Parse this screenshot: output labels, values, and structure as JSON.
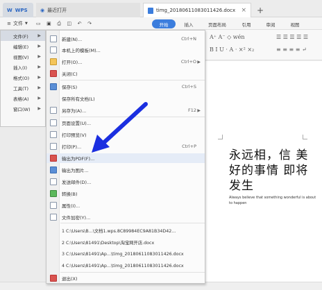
{
  "tabs": {
    "wps": "WPS",
    "recent": "最近打开",
    "doc": "timg_20180611083011426.docx",
    "new_tab": "+"
  },
  "toolbar": {
    "file_menu": "文件",
    "ribbon_tabs": [
      "开始",
      "插入",
      "页面布局",
      "引用",
      "审阅",
      "视图"
    ]
  },
  "ribbon": {
    "font_format": "A⁺ A⁻  ◇  wén",
    "style_row": "B  I  U  ·  A  ·  ×²  ×₂",
    "para_row": "☰ ☰ ☰ ☰ ☰",
    "para_row2": "≡ ≡ ≡ ≡  ↵"
  },
  "submenu": {
    "items": [
      {
        "label": "文件(F)",
        "active": true
      },
      {
        "label": "编辑(E)"
      },
      {
        "label": "视图(V)"
      },
      {
        "label": "插入(I)"
      },
      {
        "label": "格式(O)"
      },
      {
        "label": "工具(T)"
      },
      {
        "label": "表格(A)"
      },
      {
        "label": "窗口(W)"
      }
    ]
  },
  "menu": {
    "items": [
      {
        "label": "新建(N)...",
        "shortcut": "Ctrl+N",
        "icon": "new-document-icon"
      },
      {
        "label": "本机上的模板(M)...",
        "icon": "template-icon"
      },
      {
        "label": "打开(O)...",
        "shortcut": "Ctrl+O",
        "icon": "open-folder-icon"
      },
      {
        "label": "关闭(C)",
        "icon": "close-document-icon"
      },
      {
        "label": "保存(S)",
        "shortcut": "Ctrl+S",
        "icon": "save-icon"
      },
      {
        "label": "保存所有文档(L)",
        "icon": "save-all-icon"
      },
      {
        "label": "另存为(A)...",
        "shortcut": "F12",
        "icon": "save-as-icon"
      },
      {
        "label": "页面设置(U)...",
        "icon": "page-setup-icon"
      },
      {
        "label": "打印预览(V)",
        "icon": "print-preview-icon"
      },
      {
        "label": "打印(P)...",
        "shortcut": "Ctrl+P",
        "icon": "print-icon"
      },
      {
        "label": "输出为PDF(F)...",
        "icon": "pdf-export-icon"
      },
      {
        "label": "输出为图片...",
        "icon": "image-export-icon"
      },
      {
        "label": "发送邮件(D)...",
        "icon": "mail-icon"
      },
      {
        "label": "转换(B)",
        "icon": "convert-icon"
      },
      {
        "label": "属性(I)...",
        "icon": "properties-icon"
      },
      {
        "label": "文件加密(Y)...",
        "icon": "encrypt-icon"
      }
    ],
    "recent_files": [
      "1 C:\\Users\\B...\\文档1.wps.8C89984EC9A81B34D42...",
      "2 C:\\Users\\81491\\Desktop\\淘宝网开店.docx",
      "3 C:\\Users\\81491\\Ap...\\timg_20180611083011426.docx",
      "4 C:\\Users\\81491\\Ap...\\timg_20180611083011426.docx"
    ],
    "exit": "退出(X)"
  },
  "document": {
    "heading": "永远相，信 美好的事情 即将发生",
    "subtitle": "Always believe that something wonderful is about to happen"
  },
  "colors": {
    "accent": "#3b7ddd",
    "arrow": "#1b2fe0",
    "highlight": "#e5ecf7"
  }
}
